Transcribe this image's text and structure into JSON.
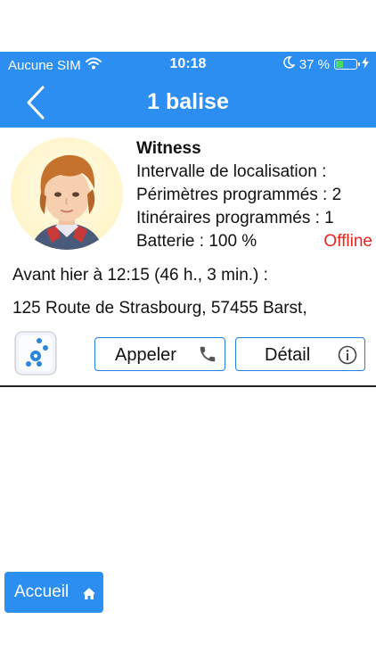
{
  "status_bar": {
    "carrier": "Aucune SIM",
    "time": "10:18",
    "battery_percent_text": "37 %",
    "battery_level": 0.37
  },
  "header": {
    "title": "1 balise"
  },
  "device": {
    "name": "Witness",
    "interval_label": "Intervalle de localisation :",
    "perimeters_text": "Périmètres programmés : 2",
    "routes_text": "Itinéraires programmés : 1",
    "battery_text": "Batterie : 100 %",
    "status": "Offline",
    "last_seen": "Avant hier à 12:15 (46 h., 3 min.) :",
    "address": "125 Route de Strasbourg, 57455 Barst,"
  },
  "actions": {
    "call_label": "Appeler",
    "detail_label": "Détail"
  },
  "footer": {
    "home_label": "Accueil"
  },
  "colors": {
    "primary": "#2b8ef0",
    "offline": "#e8231b",
    "button_border": "#1f7fe0"
  }
}
